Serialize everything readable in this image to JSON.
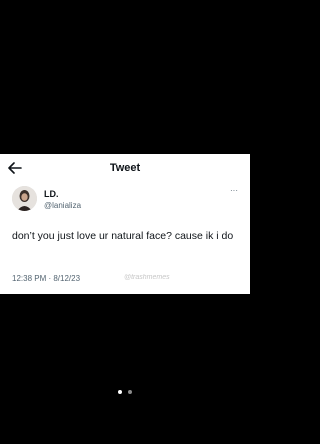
{
  "header": {
    "title": "Tweet"
  },
  "tweet": {
    "display_name": "LD.",
    "handle": "@lanializa",
    "text": "don’t you just love ur natural face? cause ik i do",
    "timestamp": "12:38 PM · 8/12/23",
    "more_glyph": "···"
  },
  "watermark": {
    "text": "@trashmemes"
  },
  "pager": {
    "current_page": 1,
    "total_pages": 2
  },
  "colors": {
    "background": "#000000",
    "card": "#ffffff",
    "primary_text": "#0f1419",
    "secondary_text": "#536471",
    "dot_active": "#ffffff",
    "dot_inactive": "#8a8a8a"
  }
}
